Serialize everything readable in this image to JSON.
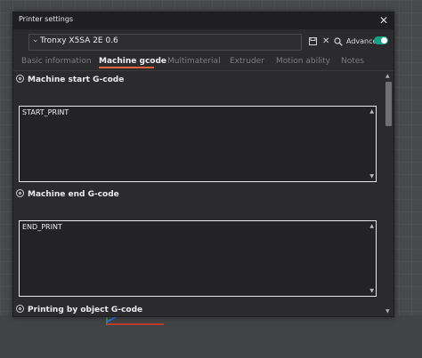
{
  "window": {
    "title": "Printer settings",
    "close_icon": "close-icon"
  },
  "preset": {
    "selected": "Tronxy X5SA 2E 0.6"
  },
  "toolbar": {
    "save_icon": "save-icon",
    "delete_icon": "delete-icon",
    "search_icon": "search-icon",
    "advance_label": "Advance",
    "advance_on": true,
    "toggle_color": "#16a085"
  },
  "tabs": [
    {
      "label": "Basic information",
      "active": false
    },
    {
      "label": "Machine gcode",
      "active": true
    },
    {
      "label": "Multimaterial",
      "active": false
    },
    {
      "label": "Extruder",
      "active": false
    },
    {
      "label": "Motion ability",
      "active": false
    },
    {
      "label": "Notes",
      "active": false
    }
  ],
  "accent_color": "#e0633a",
  "sections": [
    {
      "title": "Machine start G-code",
      "code": "START_PRINT"
    },
    {
      "title": "Machine end G-code",
      "code": "END_PRINT"
    },
    {
      "title": "Printing by object G-code",
      "code": ""
    }
  ]
}
